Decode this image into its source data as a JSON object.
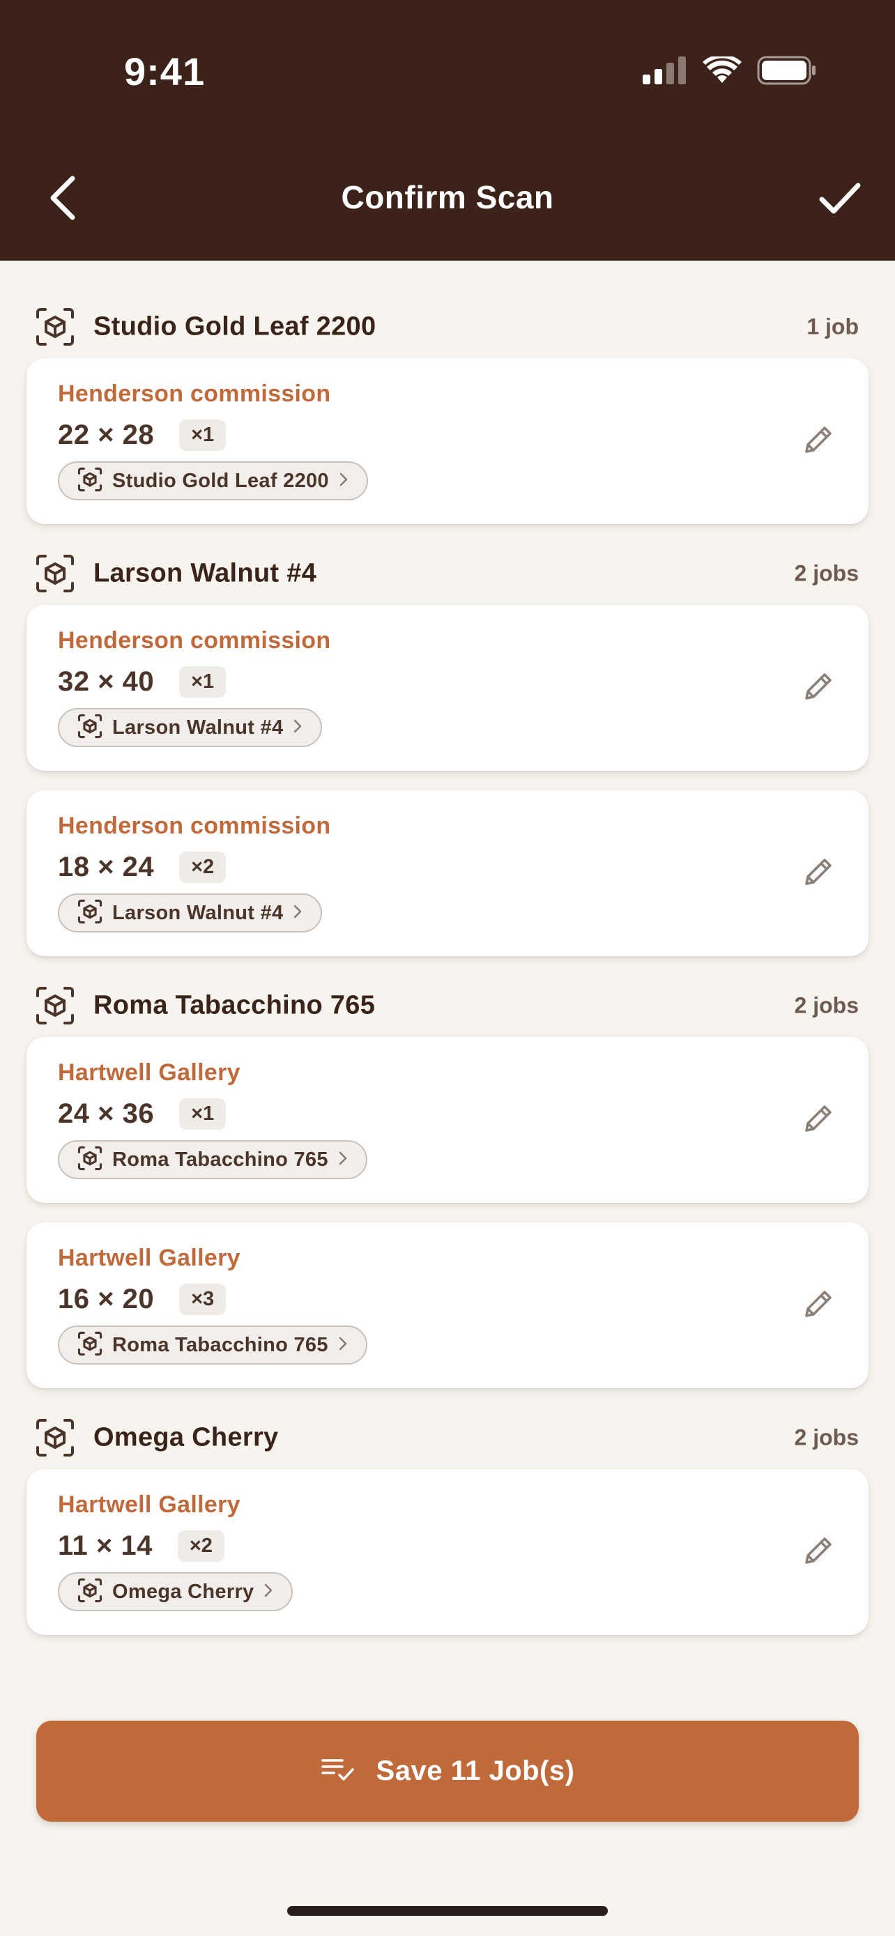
{
  "status_bar": {
    "time": "9:41"
  },
  "nav": {
    "title": "Confirm Scan",
    "back_icon": "chevron-left-icon",
    "confirm_icon": "checkmark-icon"
  },
  "colors": {
    "header_bg": "#3c2219",
    "accent": "#c06a3c",
    "page_bg": "#f7f4ef",
    "text_dark": "#3a2419"
  },
  "groups": [
    {
      "title": "Studio Gold Leaf 2200",
      "count": "1 job",
      "icon": "scan-box-icon",
      "jobs": [
        {
          "client": "Henderson commission",
          "dims": "22 × 28",
          "qty": "×1",
          "moulding": "Studio Gold Leaf 2200"
        }
      ]
    },
    {
      "title": "Larson Walnut #4",
      "count": "2 jobs",
      "icon": "scan-box-icon",
      "jobs": [
        {
          "client": "Henderson commission",
          "dims": "32 × 40",
          "qty": "×1",
          "moulding": "Larson Walnut #4"
        },
        {
          "client": "Henderson commission",
          "dims": "18 × 24",
          "qty": "×2",
          "moulding": "Larson Walnut #4"
        }
      ]
    },
    {
      "title": "Roma Tabacchino 765",
      "count": "2 jobs",
      "icon": "scan-box-icon",
      "jobs": [
        {
          "client": "Hartwell Gallery",
          "dims": "24 × 36",
          "qty": "×1",
          "moulding": "Roma Tabacchino 765"
        },
        {
          "client": "Hartwell Gallery",
          "dims": "16 × 20",
          "qty": "×3",
          "moulding": "Roma Tabacchino 765"
        }
      ]
    },
    {
      "title": "Omega Cherry",
      "count": "2 jobs",
      "icon": "scan-box-icon",
      "jobs": [
        {
          "client": "Hartwell Gallery",
          "dims": "11 × 14",
          "qty": "×2",
          "moulding": "Omega Cherry"
        }
      ]
    }
  ],
  "save_button": {
    "label": "Save 11 Job(s)",
    "icon": "list-check-icon"
  }
}
